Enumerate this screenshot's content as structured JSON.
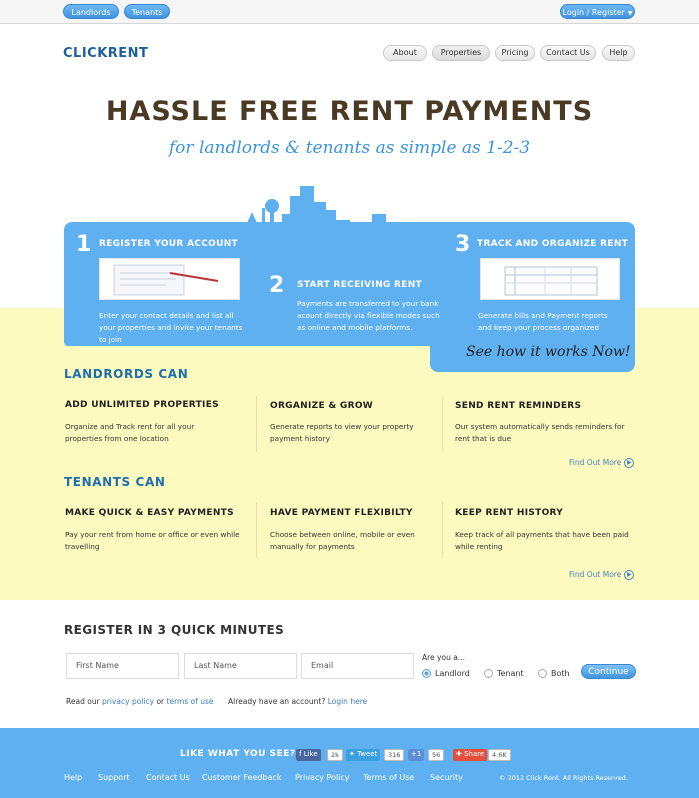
{
  "topbar": {
    "landlords": "Landlords",
    "tenants": "Tenants",
    "login": "Login / Register"
  },
  "header": {
    "logo": "CLICKRENT",
    "nav": [
      "About",
      "Properties",
      "Pricing",
      "Contact Us",
      "Help"
    ]
  },
  "hero": {
    "title": "HASSLE FREE RENT PAYMENTS",
    "subtitle": "for landlords & tenants as simple as 1-2-3"
  },
  "steps": [
    {
      "num": "1",
      "title": "REGISTER YOUR ACCOUNT",
      "desc": "Enter your contact details and list all your properties and invite your tenants to join"
    },
    {
      "num": "2",
      "title": "START RECEIVING RENT",
      "desc": "Payments are transferred to your bank acount directly via flexible modes such as online and mobile platforms."
    },
    {
      "num": "3",
      "title": "TRACK AND ORGANIZE RENT",
      "desc": "Generate bills and Payment reports and keep your process organized"
    }
  ],
  "see_how": "See how it works Now!",
  "landlords": {
    "heading": "LANDRORDS CAN",
    "features": [
      {
        "title": "ADD UNLIMITED PROPERTIES",
        "desc": "Organize and Track rent for all your properties from one location"
      },
      {
        "title": "ORGANIZE & GROW",
        "desc": "Generate reports to view your property payment history"
      },
      {
        "title": "SEND RENT REMINDERS",
        "desc": "Our system automatically sends reminders for rent that is due"
      }
    ],
    "find_more": "Find Out More"
  },
  "tenants": {
    "heading": "TENANTS CAN",
    "features": [
      {
        "title": "MAKE QUICK & EASY PAYMENTS",
        "desc": "Pay your rent from home or office or even while travelling"
      },
      {
        "title": "HAVE PAYMENT FLEXIBILTY",
        "desc": "Choose between online, mobile or even manually for payments"
      },
      {
        "title": "KEEP RENT HISTORY",
        "desc": "Keep track of all payments that have been paid while renting"
      }
    ],
    "find_more": "Find Out More"
  },
  "register": {
    "heading": "REGISTER IN 3 QUICK MINUTES",
    "first_name": "First Name",
    "last_name": "Last Name",
    "email": "Email",
    "are_you": "Are you a...",
    "options": [
      "Landlord",
      "Tenant",
      "Both"
    ],
    "selected": "Landlord",
    "continue": "Continue",
    "legal_prefix": "Read our",
    "privacy": "privacy policy",
    "or": "or",
    "terms": "terms of use",
    "already": "Already have an account?",
    "login": "Login here"
  },
  "footer": {
    "like": "LIKE WHAT YOU SEE?",
    "fb_label": "Like",
    "fb_count": "2k",
    "tw_label": "Tweet",
    "tw_count": "316",
    "gp_label": "+1",
    "gp_count": "56",
    "share_label": "Share",
    "share_count": "4.6K",
    "links": [
      "Help",
      "Support",
      "Contact Us",
      "Customer Feedback",
      "Privacy Policy",
      "Terms of Use",
      "Security"
    ],
    "copyright": "© 2012 Click Rent. All Rights Reserved."
  },
  "colors": {
    "brand_blue": "#5fb0f1",
    "yellow": "#fdfabf",
    "heading_blue": "#1f6fae"
  }
}
